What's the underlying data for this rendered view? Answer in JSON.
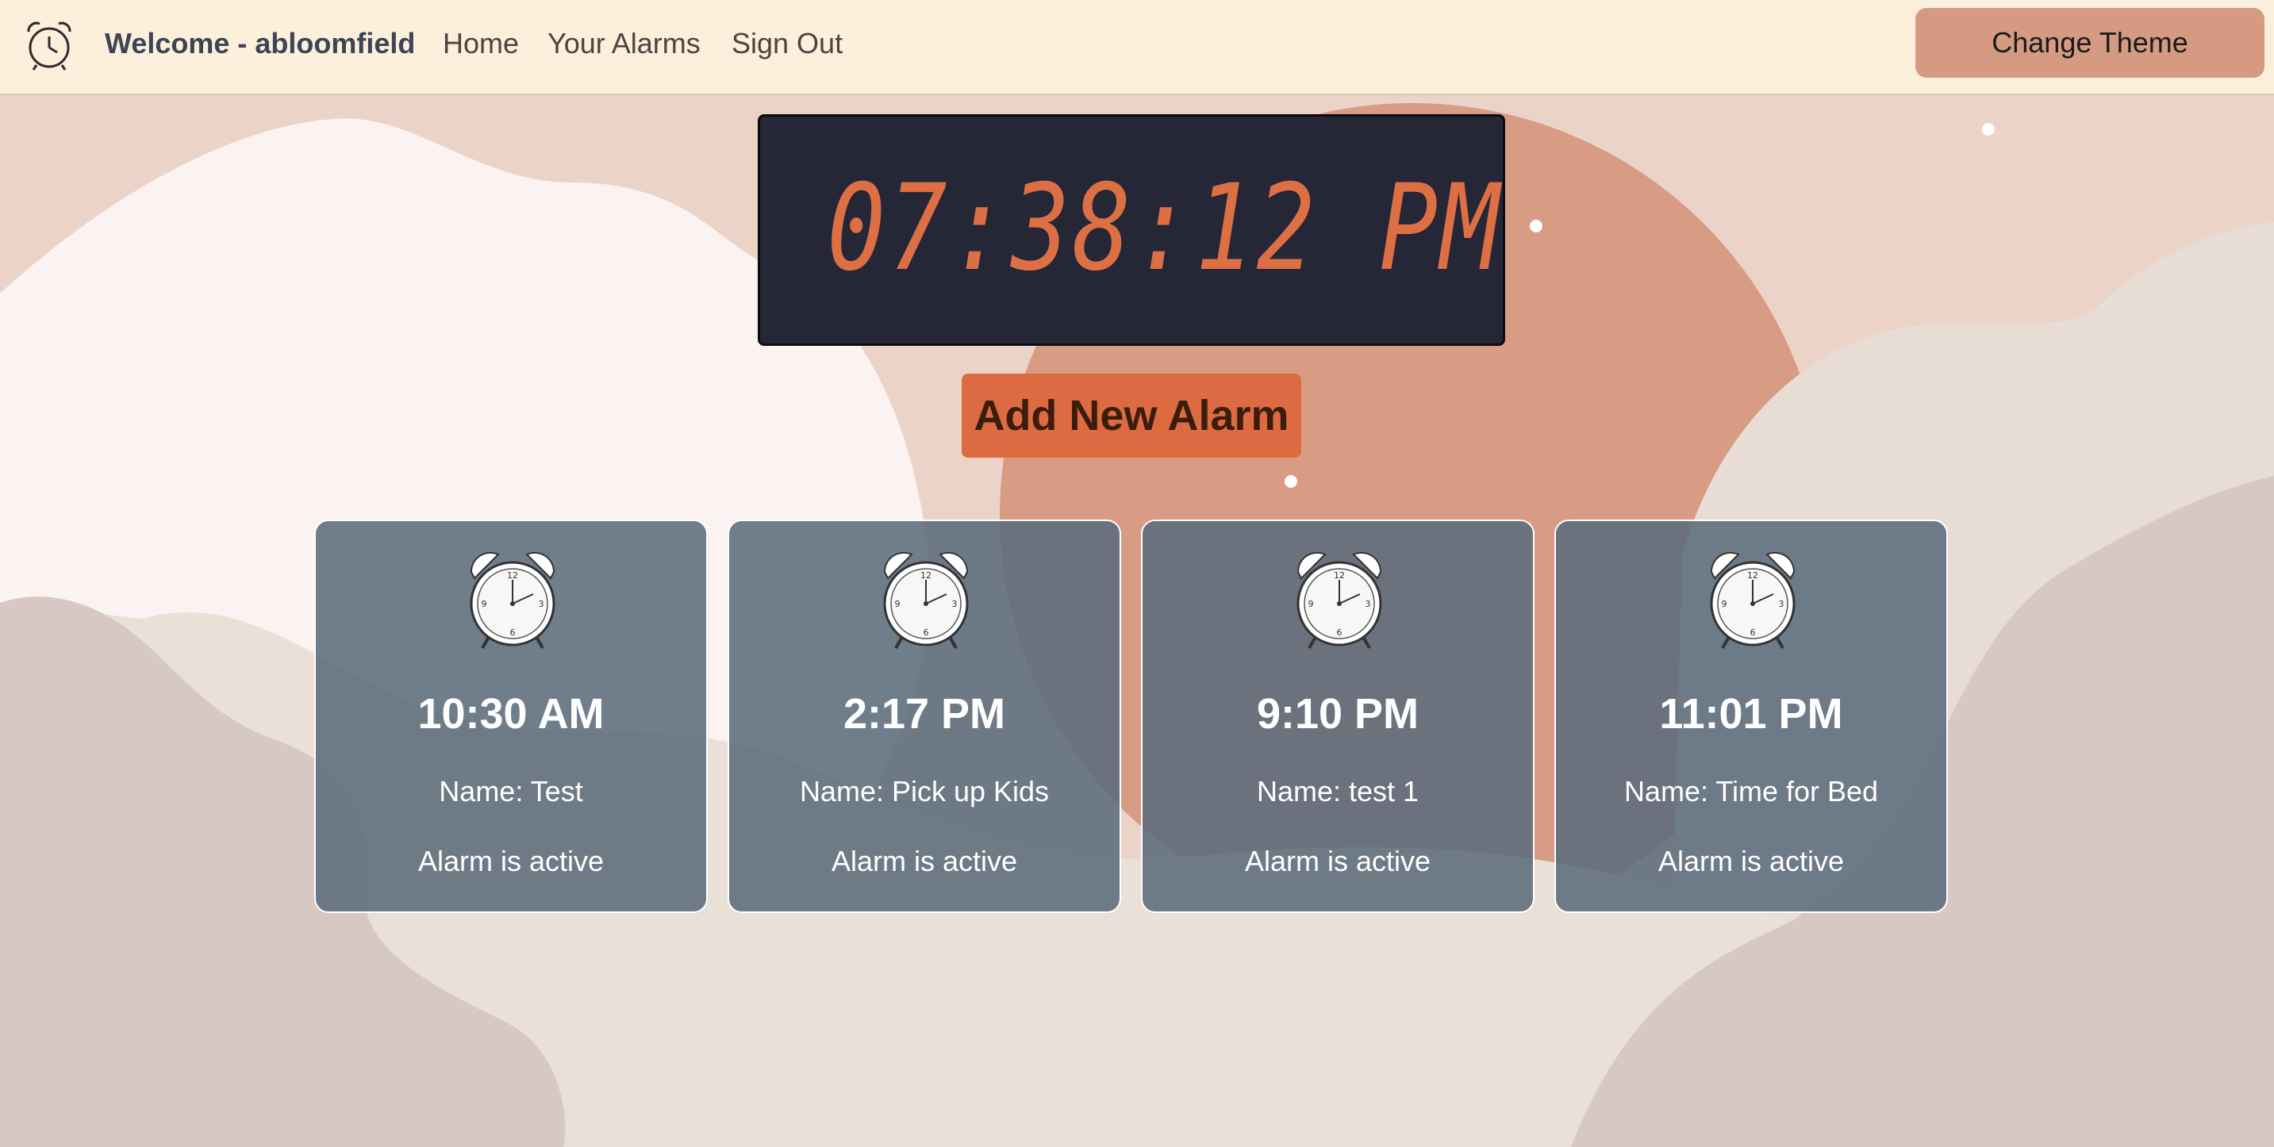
{
  "nav": {
    "welcome": "Welcome - abloomfield",
    "links": [
      "Home",
      "Your Alarms",
      "Sign Out"
    ],
    "theme_button": "Change Theme"
  },
  "clock": {
    "time": "07:38:12 PM"
  },
  "add_button": "Add New Alarm",
  "alarms": [
    {
      "time": "10:30 AM",
      "name": "Name: Test",
      "status": "Alarm is active"
    },
    {
      "time": "2:17 PM",
      "name": "Name: Pick up Kids",
      "status": "Alarm is active"
    },
    {
      "time": "9:10 PM",
      "name": "Name: test 1",
      "status": "Alarm is active"
    },
    {
      "time": "11:01 PM",
      "name": "Name: Time for Bed",
      "status": "Alarm is active"
    }
  ],
  "icons": {
    "logo": "alarm-clock-icon",
    "card": "alarm-clock-icon"
  },
  "colors": {
    "nav_bg": "#fcefdc",
    "theme_button": "#d59a82",
    "clock_bg": "#252636",
    "clock_digits": "#dd6f45",
    "add_button": "#dc6b41",
    "card_bg": "#5c6c7c"
  }
}
